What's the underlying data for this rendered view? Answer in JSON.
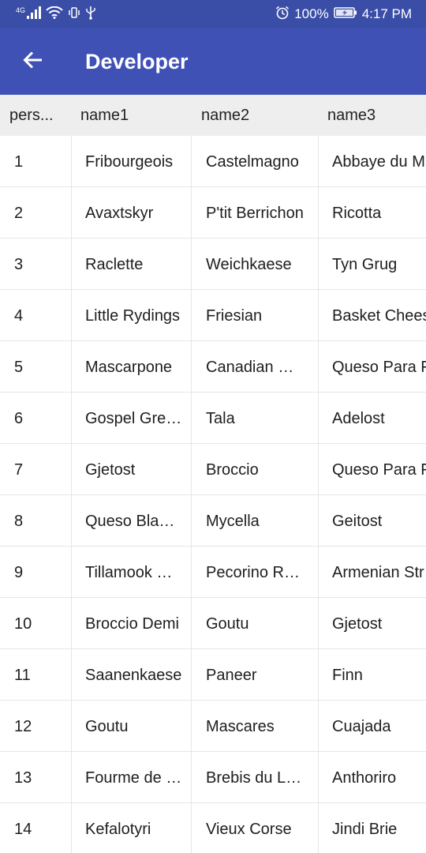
{
  "status_bar": {
    "network_type": "4G",
    "battery_percent": "100%",
    "time": "4:17 PM",
    "icons": [
      "signal-icon",
      "wifi-icon",
      "vibrate-icon",
      "usb-icon",
      "alarm-icon",
      "battery-charging-icon"
    ]
  },
  "app_bar": {
    "title": "Developer",
    "back_icon": "arrow-back-icon",
    "color": "#3f51b5"
  },
  "table": {
    "headers": [
      "pers...",
      "name1",
      "name2",
      "name3"
    ],
    "rows": [
      [
        "1",
        "Fribourgeois",
        "Castelmagno",
        "Abbaye du M"
      ],
      [
        "2",
        "Avaxtskyr",
        "P'tit Berrichon",
        "Ricotta"
      ],
      [
        "3",
        "Raclette",
        "Weichkaese",
        "Tyn Grug"
      ],
      [
        "4",
        "Little Rydings",
        "Friesian",
        "Basket Chees"
      ],
      [
        "5",
        "Mascarpone",
        "Canadian Cheddar",
        "Queso Para F"
      ],
      [
        "6",
        "Gospel Green",
        "Tala",
        "Adelost"
      ],
      [
        "7",
        "Gjetost",
        "Broccio",
        "Queso Para F"
      ],
      [
        "8",
        "Queso Blanco",
        "Mycella",
        "Geitost"
      ],
      [
        "9",
        "Tillamook Cheddar",
        "Pecorino Romano",
        "Armenian Str"
      ],
      [
        "10",
        "Broccio Demi",
        "Goutu",
        "Gjetost"
      ],
      [
        "11",
        "Saanenkaese",
        "Paneer",
        "Finn"
      ],
      [
        "12",
        "Goutu",
        "Mascares",
        "Cuajada"
      ],
      [
        "13",
        "Fourme de Montbrison",
        "Brebis du Lochois",
        "Anthoriro"
      ],
      [
        "14",
        "Kefalotyri",
        "Vieux Corse",
        "Jindi Brie"
      ]
    ]
  }
}
